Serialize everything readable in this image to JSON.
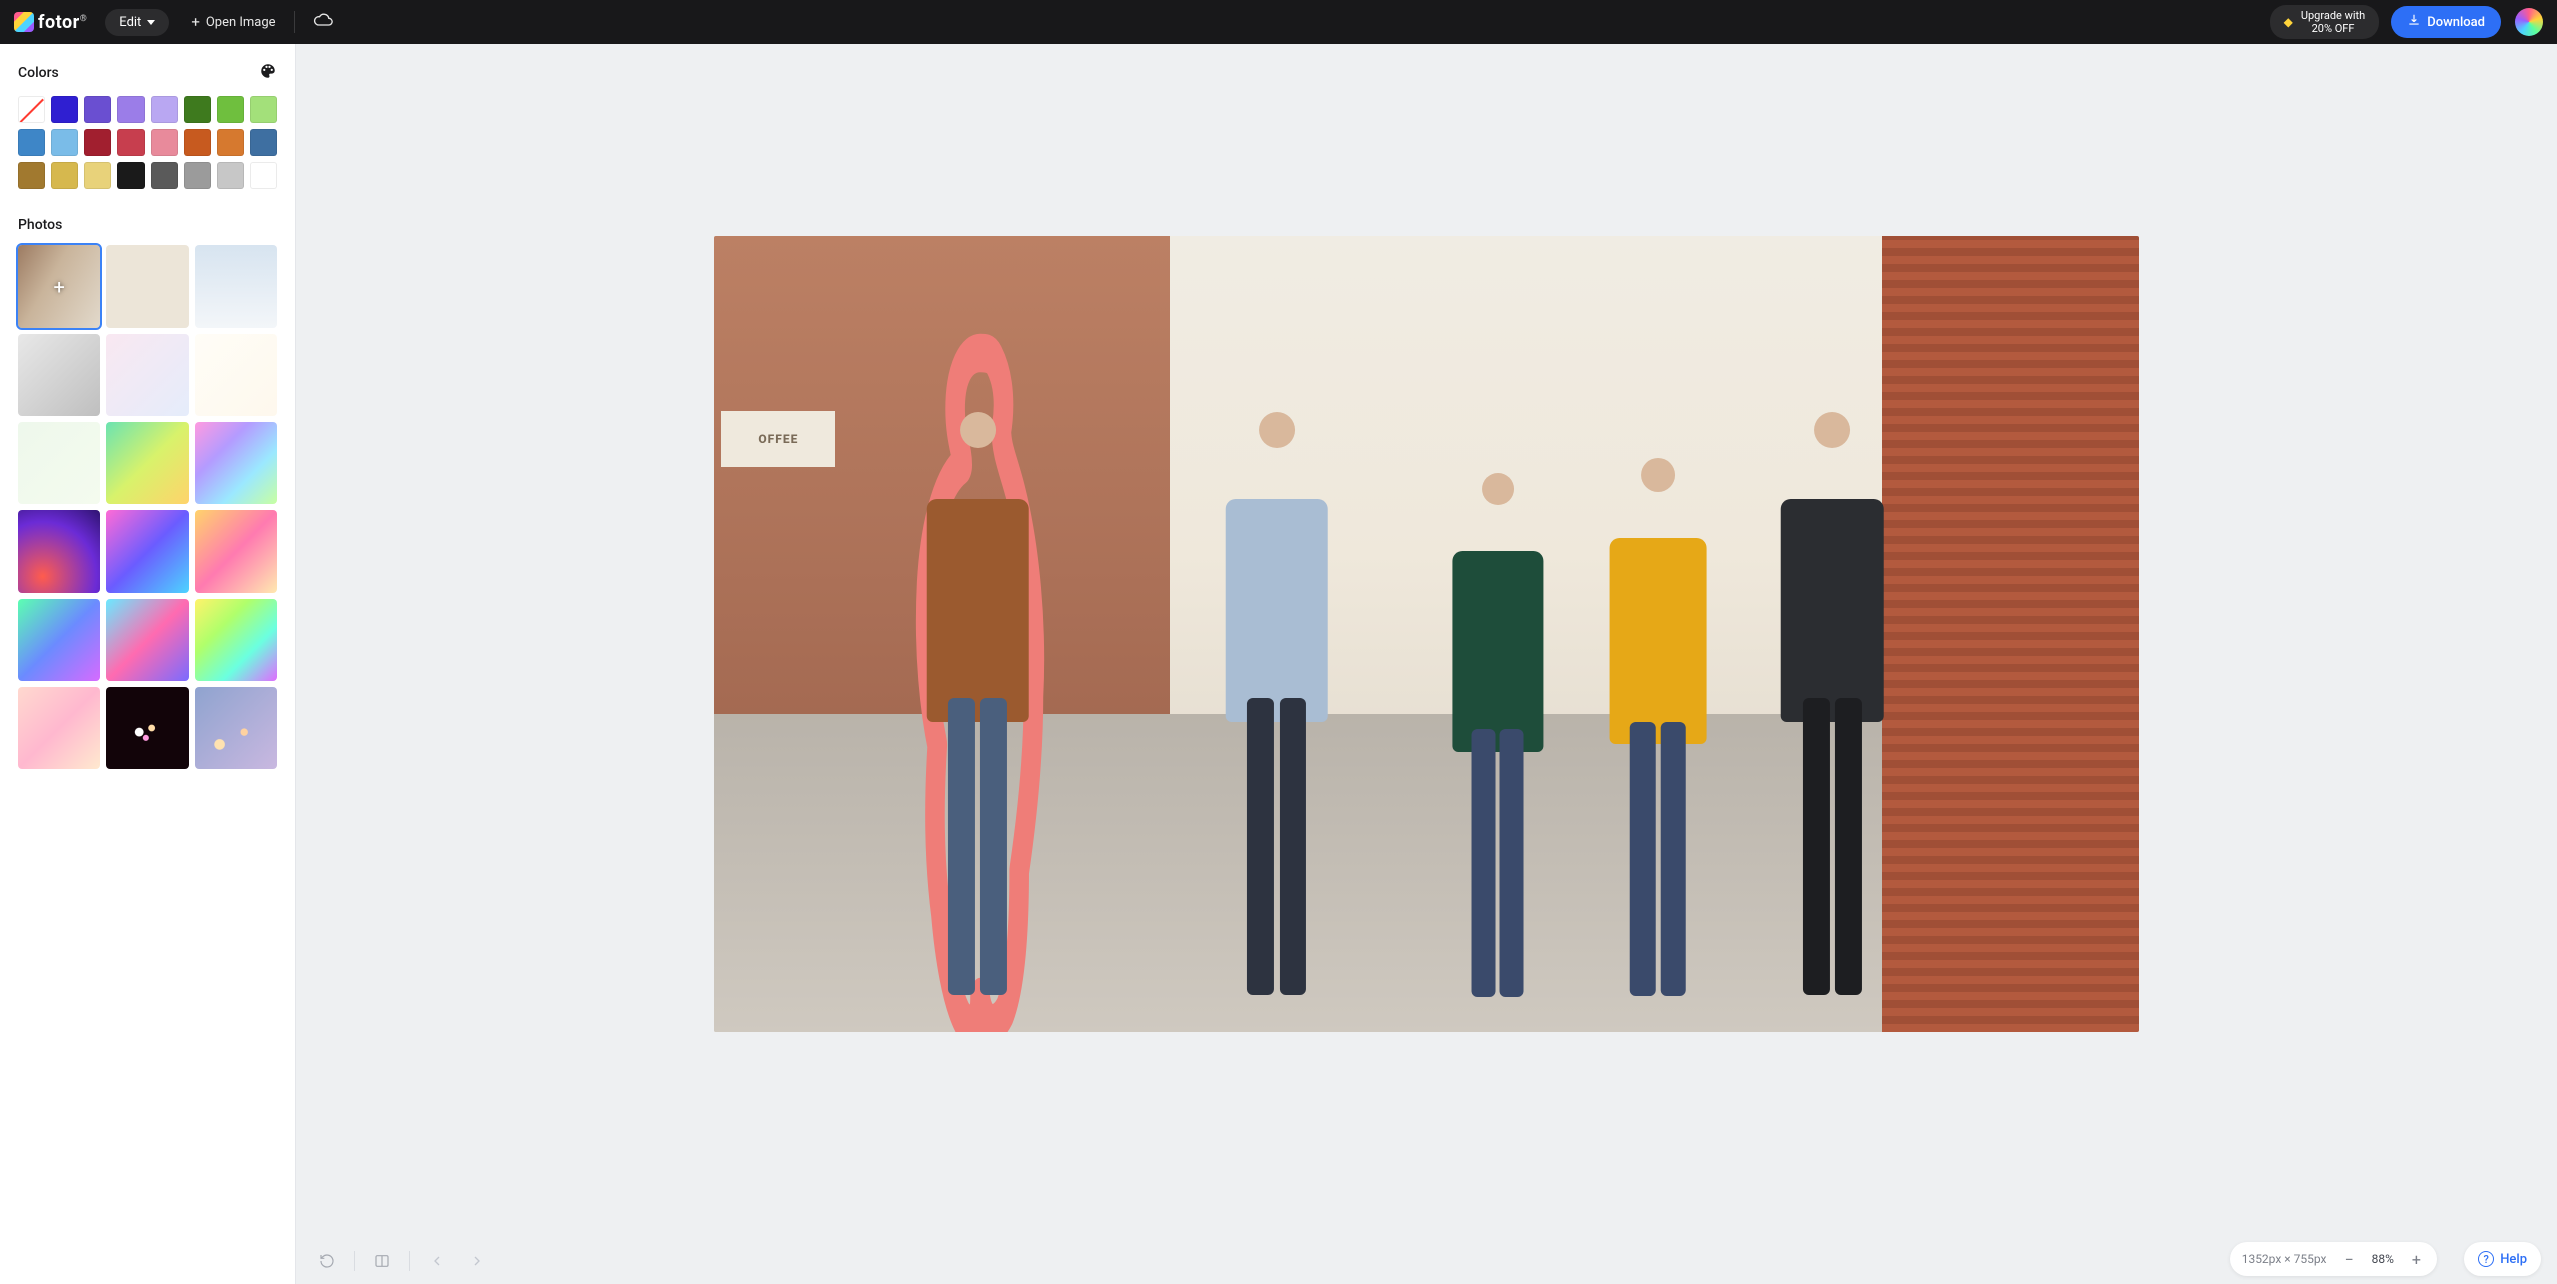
{
  "header": {
    "logo_text": "fotor",
    "edit_label": "Edit",
    "open_image_label": "Open Image",
    "upgrade_line1": "Upgrade with",
    "upgrade_line2": "20% OFF",
    "download_label": "Download"
  },
  "sidebar": {
    "colors_title": "Colors",
    "photos_title": "Photos",
    "colors": [
      "none",
      "#2f1fd1",
      "#6a4fd1",
      "#9b7de8",
      "#b9a7f2",
      "#3e7a1e",
      "#6fbf3e",
      "#a3e07a",
      "#3e86c7",
      "#7abce8",
      "#a11f2f",
      "#c73e4e",
      "#e88a9b",
      "#c75a1f",
      "#d6792f",
      "#3e6fa1",
      "#a1792f",
      "#d6b84e",
      "#e8d27a",
      "#1a1a1a",
      "#5a5a5a",
      "#9b9b9b",
      "#c7c7c7",
      "#ffffff"
    ],
    "photos": [
      {
        "selected": true,
        "cls": "th0"
      },
      {
        "selected": false,
        "cls": "th1"
      },
      {
        "selected": false,
        "cls": "th2"
      },
      {
        "selected": false,
        "cls": "th3"
      },
      {
        "selected": false,
        "cls": "th4"
      },
      {
        "selected": false,
        "cls": "th5"
      },
      {
        "selected": false,
        "cls": "th6"
      },
      {
        "selected": false,
        "cls": "th7"
      },
      {
        "selected": false,
        "cls": "th8"
      },
      {
        "selected": false,
        "cls": "th9"
      },
      {
        "selected": false,
        "cls": "th10"
      },
      {
        "selected": false,
        "cls": "th11"
      },
      {
        "selected": false,
        "cls": "th12"
      },
      {
        "selected": false,
        "cls": "th13"
      },
      {
        "selected": false,
        "cls": "th14"
      },
      {
        "selected": false,
        "cls": "th15"
      },
      {
        "selected": false,
        "cls": "th16"
      },
      {
        "selected": false,
        "cls": "th17"
      }
    ]
  },
  "canvas": {
    "coffee_text": "OFFEE"
  },
  "footer": {
    "dimensions": "1352px × 755px",
    "zoom": "88%",
    "help_label": "Help"
  }
}
